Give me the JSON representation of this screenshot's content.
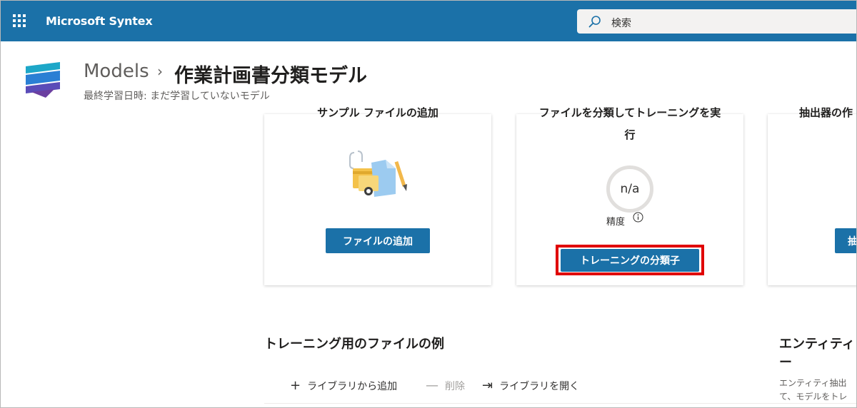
{
  "appbar": {
    "app_name": "Microsoft Syntex",
    "search_placeholder": "検索",
    "color": "#1b71a8"
  },
  "header": {
    "breadcrumb_root": "Models",
    "breadcrumb_separator": "›",
    "title": "作業計画書分類モデル",
    "subtitle": "最終学習日時: まだ学習していないモデル"
  },
  "cards": [
    {
      "title": "サンプル ファイルの追加",
      "button_label": "ファイルの追加",
      "icon": "documents-illustration"
    },
    {
      "title_line1": "ファイルを分類してトレーニングを実",
      "title_line2": "行",
      "accuracy_value": "n/a",
      "accuracy_label": "精度",
      "button_label": "トレーニングの分類子",
      "highlight_color": "#e00000"
    },
    {
      "title": "抽出器の作",
      "button_label": "抽"
    }
  ],
  "sections": {
    "training_files": {
      "title": "トレーニング用のファイルの例",
      "commands": {
        "add": "ライブラリから追加",
        "delete": "削除",
        "open": "ライブラリを開く"
      }
    },
    "entity": {
      "title": "エンティティー",
      "desc_line1": "エンティティ抽出",
      "desc_line2": "て、モデルをトレ"
    }
  }
}
